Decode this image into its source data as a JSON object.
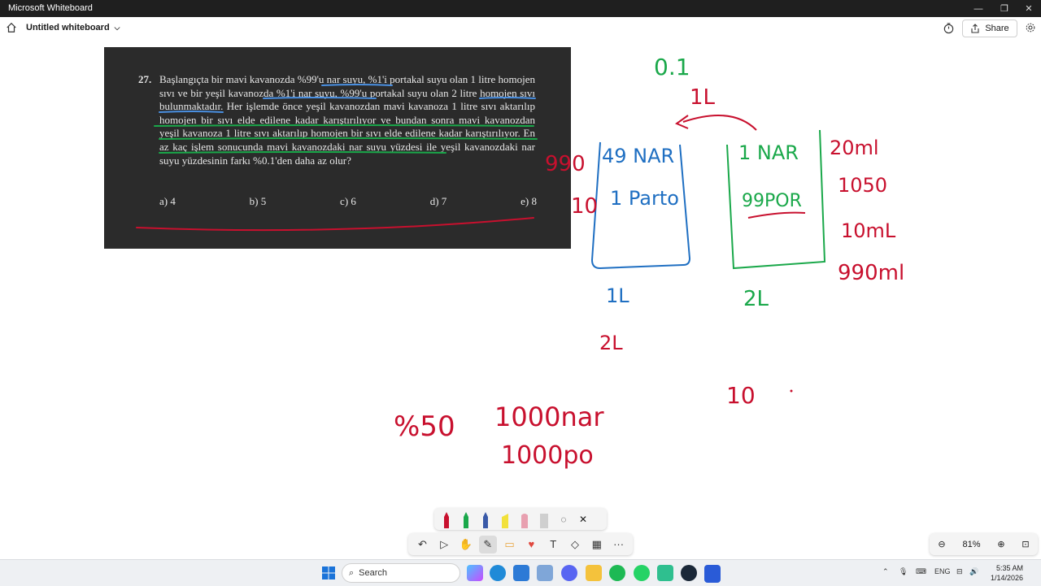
{
  "window": {
    "app_name": "Microsoft Whiteboard"
  },
  "appbar": {
    "board_name": "Untitled whiteboard",
    "share_label": "Share"
  },
  "problem": {
    "number": "27.",
    "text": "Başlangıçta bir mavi kavanozda %99'u nar suyu, %1'i portakal suyu olan 1 litre homojen sıvı ve bir yeşil kavanozda %1'i nar suyu, %99'u portakal suyu olan 2 litre homojen sıvı bulunmaktadır. Her işlemde önce yeşil kavanozdan mavi kavanoza 1 litre sıvı aktarılıp homojen bir sıvı elde edilene kadar karıştırılıyor ve bundan sonra mavi kavanozdan yeşil kavanoza 1 litre sıvı aktarılıp homojen bir sıvı elde edilene kadar karıştırılıyor. En az kaç işlem sonucunda mavi kavanozdaki nar suyu yüzdesi ile yeşil kavanozdaki nar suyu yüzdesinin farkı %0.1'den daha az olur?",
    "options": [
      "a) 4",
      "b) 5",
      "c) 6",
      "d) 7",
      "e) 8"
    ]
  },
  "ink": {
    "top_a": "0.1",
    "top_b": "1L",
    "blue_jar_line1": "49 NAR",
    "blue_jar_line2": "1 Parto",
    "left_990": "990",
    "left_10": "10",
    "blue_cap": "1L",
    "blue_cap2": "2L",
    "green_jar_line1": "1 NAR",
    "green_jar_line2": "99POR",
    "green_cap": "2L",
    "right_1": "20ml",
    "right_2": "1050",
    "right_3": "10mL",
    "right_4": "990ml",
    "bottom_pct": "%50",
    "bottom_nar": "1000nar",
    "bottom_po": "1000po",
    "bottom_10": "10"
  },
  "toolbar": {
    "undo": "↶",
    "select": "▷",
    "hand": "✋",
    "pen": "✎",
    "note": "▭",
    "reaction": "♥",
    "text": "T",
    "shapes": "◇",
    "table": "▦",
    "more": "···"
  },
  "zoom": {
    "level": "81%"
  },
  "taskbar": {
    "search_placeholder": "Search",
    "lang": "ENG",
    "time": "5:35 AM",
    "date": "1/14/2026"
  },
  "colors": {
    "ink_red": "#c8102e",
    "ink_blue": "#1f6fc2",
    "ink_green": "#1aa84a",
    "problem_bg": "#2b2b2b"
  }
}
